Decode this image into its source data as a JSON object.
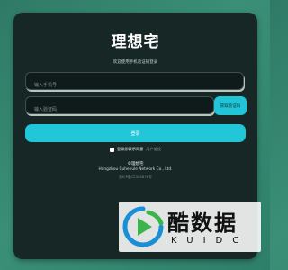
{
  "login": {
    "title": "理想宅",
    "subtitle": "欢迎使用手机验证码登录",
    "phone_placeholder": "输入手机号",
    "code_placeholder": "输入验证码",
    "get_code_label": "获取验证码",
    "login_label": "登录",
    "agree_text": "登录即表示同意",
    "agree_link": "用户协议"
  },
  "footer": {
    "brand": "©理想宅",
    "company": "Hangzhou Cuhehule Network Co., Ltd.",
    "icp": "浙ICP备12345678号"
  },
  "watermark": {
    "brand_cn": "酷数据",
    "brand_en": "KUIDC"
  },
  "colors": {
    "accent": "#22c6d9",
    "card": "#172726",
    "background": "#3a8f76"
  }
}
